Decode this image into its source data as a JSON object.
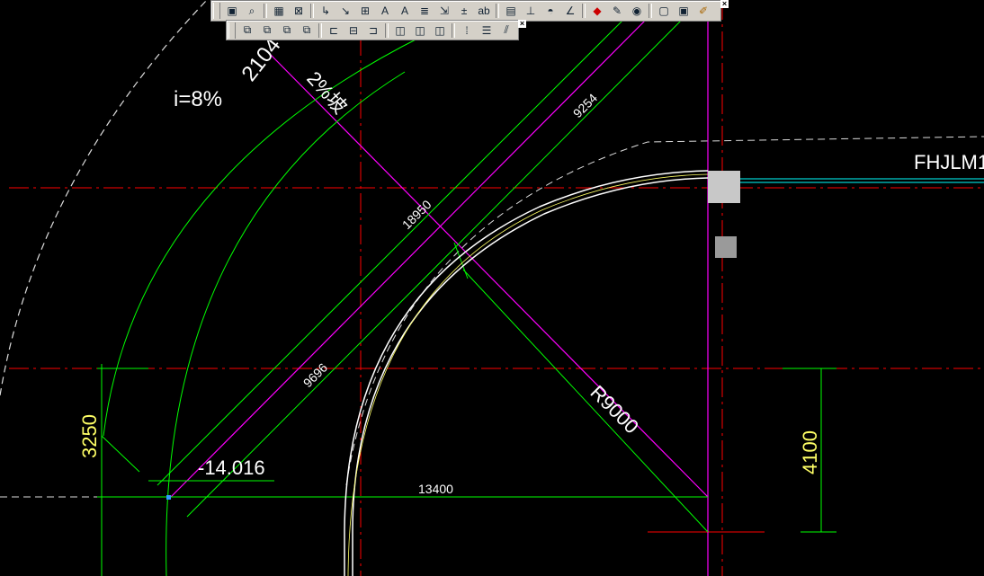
{
  "toolbar_main": {
    "buttons": [
      {
        "icon": "paper-icon"
      },
      {
        "icon": "zoom-icon"
      },
      {
        "icon": "grid-icon"
      },
      {
        "icon": "frame-icon"
      },
      {
        "icon": "leader-icon"
      },
      {
        "icon": "leader-alt-icon"
      },
      {
        "icon": "align-icon"
      },
      {
        "icon": "text-align-icon"
      },
      {
        "icon": "text-icon"
      },
      {
        "icon": "multiline-text-icon"
      },
      {
        "icon": "export-icon"
      },
      {
        "icon": "elevation-icon"
      },
      {
        "icon": "abbrev-icon"
      },
      {
        "icon": "table-icon"
      },
      {
        "icon": "dim-icon"
      },
      {
        "icon": "stamp-icon"
      },
      {
        "icon": "angle-icon"
      },
      {
        "icon": "eraser-icon"
      },
      {
        "icon": "pencil-icon"
      },
      {
        "icon": "eye-icon"
      },
      {
        "icon": "window-icon"
      },
      {
        "icon": "layout-icon"
      },
      {
        "icon": "brush-icon"
      }
    ]
  },
  "toolbar_align": {
    "buttons": [
      {
        "icon": "layer-a-icon"
      },
      {
        "icon": "layer-b-icon"
      },
      {
        "icon": "layer-c-icon"
      },
      {
        "icon": "layer-d-icon"
      },
      {
        "icon": "align-left-icon"
      },
      {
        "icon": "align-mid-icon"
      },
      {
        "icon": "align-right-icon"
      },
      {
        "icon": "dist-a-icon"
      },
      {
        "icon": "dist-b-icon"
      },
      {
        "icon": "dist-c-icon"
      },
      {
        "icon": "grid-a-icon"
      },
      {
        "icon": "list-icon"
      },
      {
        "icon": "hatch-icon"
      }
    ]
  },
  "drawing": {
    "slope_label": "i=8%",
    "dim_2104": "2104",
    "slope_text": "2%坡",
    "dim_9254": "9254",
    "dim_18950": "18950",
    "dim_9696": "9696",
    "dim_r9000": "R9000",
    "dim_3250": "3250",
    "elev": "-14.016",
    "dim_13400": "13400",
    "dim_4100": "4100",
    "tag_fhjlm": "FHJLM1"
  },
  "colors": {
    "green": "#00ff00",
    "magenta": "#ff00ff",
    "red": "#ff0000",
    "white": "#ffffff",
    "yellow": "#ffff66",
    "cyan": "#00ffff"
  }
}
